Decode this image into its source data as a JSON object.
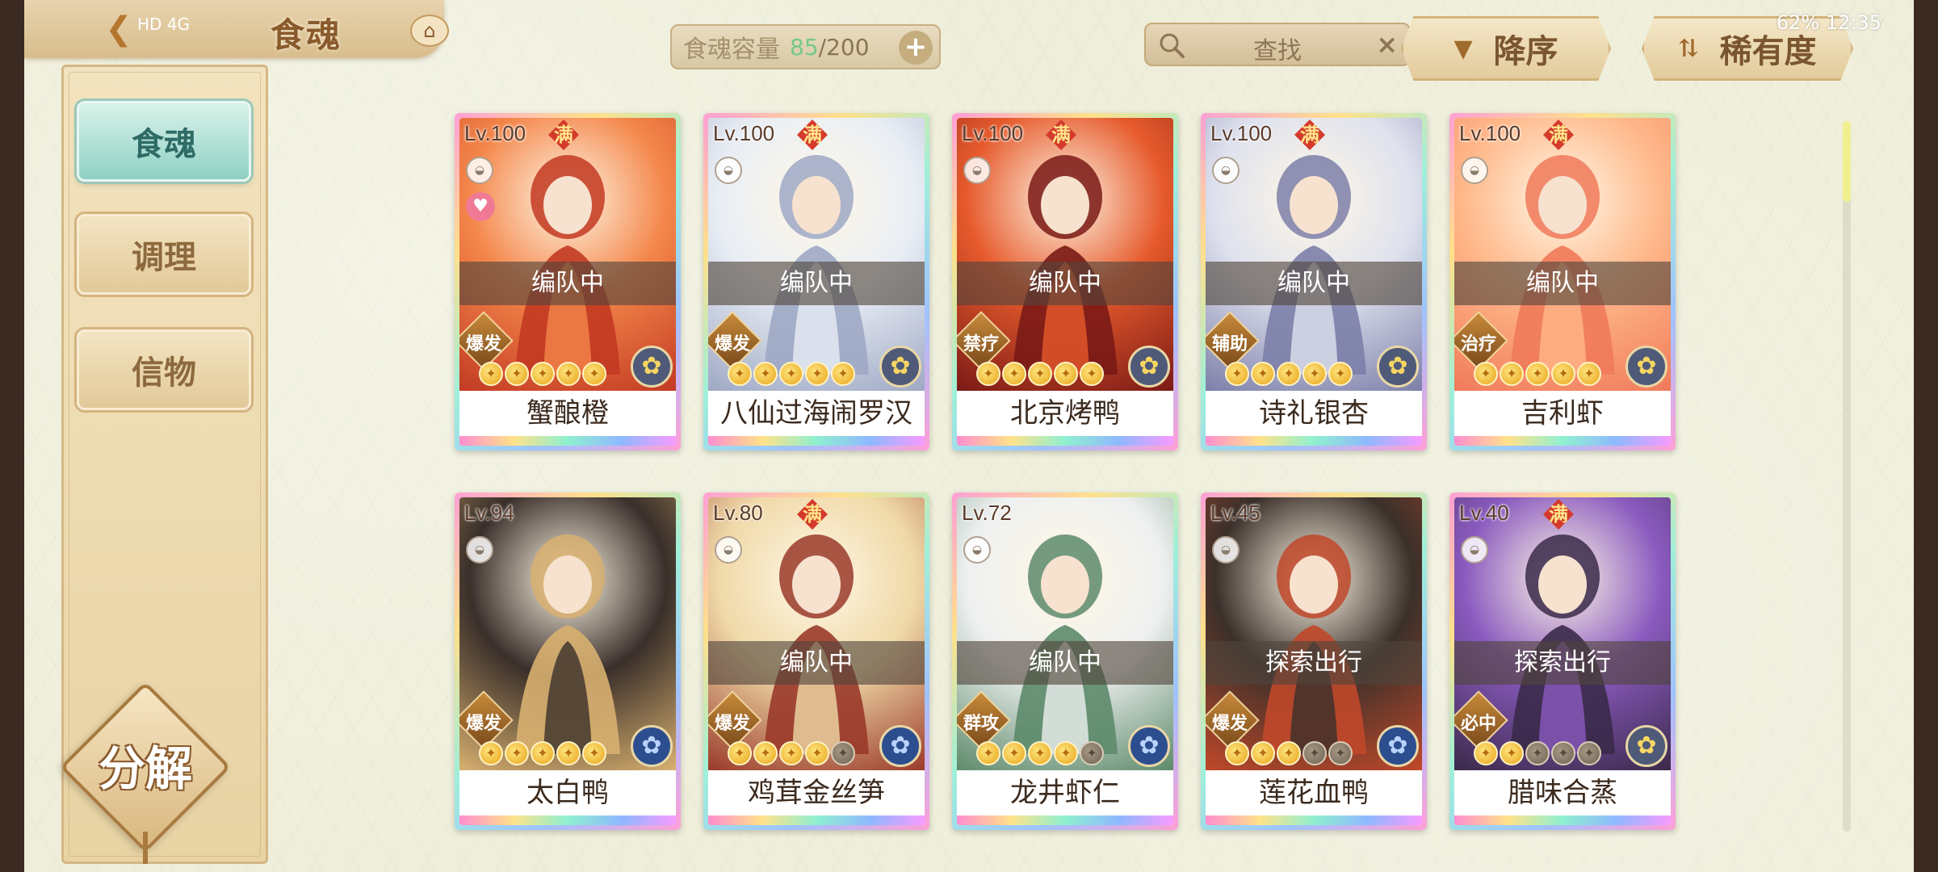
{
  "header": {
    "title": "食魂",
    "status_left": "HD 4G",
    "status_right": "62% 12:35",
    "back_icon": "back-arrow-icon",
    "home_icon": "pavilion-icon"
  },
  "capacity": {
    "label": "食魂容量",
    "current": "85",
    "separator": "/",
    "max": "200",
    "current_color": "#75c98b"
  },
  "search": {
    "placeholder": "查找",
    "clear": "×"
  },
  "sort": {
    "order_label": "降序",
    "rarity_label": "稀有度"
  },
  "sidebar": {
    "items": [
      {
        "label": "食魂",
        "active": true
      },
      {
        "label": "调理",
        "active": false
      },
      {
        "label": "信物",
        "active": false
      }
    ],
    "decompose_label": "分解"
  },
  "cards": [
    {
      "level": "Lv.100",
      "full": "满",
      "state": "编队中",
      "role": "爆发",
      "name": "蟹酿橙",
      "stars": 5,
      "max_stars": 5,
      "element": "gold",
      "palette": [
        "#f4864a",
        "#c23a22"
      ],
      "heart": true
    },
    {
      "level": "Lv.100",
      "full": "满",
      "state": "编队中",
      "role": "爆发",
      "name": "八仙过海闹罗汉",
      "stars": 5,
      "max_stars": 5,
      "element": "gold",
      "palette": [
        "#e9eef5",
        "#9ea8c4"
      ],
      "heart": false
    },
    {
      "level": "Lv.100",
      "full": "满",
      "state": "编队中",
      "role": "禁疗",
      "name": "北京烤鸭",
      "stars": 5,
      "max_stars": 5,
      "element": "gold",
      "palette": [
        "#e65a2c",
        "#7a1a16"
      ],
      "heart": false
    },
    {
      "level": "Lv.100",
      "full": "满",
      "state": "编队中",
      "role": "辅助",
      "name": "诗礼银杏",
      "stars": 5,
      "max_stars": 5,
      "element": "gold",
      "palette": [
        "#dfe2ee",
        "#7c7fa8"
      ],
      "heart": false
    },
    {
      "level": "Lv.100",
      "full": "满",
      "state": "编队中",
      "role": "治疗",
      "name": "吉利虾",
      "stars": 5,
      "max_stars": 5,
      "element": "gold",
      "palette": [
        "#ffb88a",
        "#f07a5a"
      ],
      "heart": false
    },
    {
      "level": "Lv.94",
      "full": "",
      "state": "",
      "role": "爆发",
      "name": "太白鸭",
      "stars": 5,
      "max_stars": 5,
      "element": "blue",
      "palette": [
        "#3a2f2a",
        "#d8b070"
      ],
      "heart": false
    },
    {
      "level": "Lv.80",
      "full": "满",
      "state": "编队中",
      "role": "爆发",
      "name": "鸡茸金丝笋",
      "stars": 4,
      "max_stars": 5,
      "element": "blue",
      "palette": [
        "#f0d9a8",
        "#9a3a2a"
      ],
      "heart": false
    },
    {
      "level": "Lv.72",
      "full": "",
      "state": "编队中",
      "role": "群攻",
      "name": "龙井虾仁",
      "stars": 4,
      "max_stars": 5,
      "element": "blue",
      "palette": [
        "#eef0f0",
        "#5d8a6a"
      ],
      "heart": false
    },
    {
      "level": "Lv.45",
      "full": "",
      "state": "探索出行",
      "role": "爆发",
      "name": "莲花血鸭",
      "stars": 3,
      "max_stars": 5,
      "element": "blue",
      "palette": [
        "#3b302a",
        "#c0482a"
      ],
      "heart": false
    },
    {
      "level": "Lv.40",
      "full": "满",
      "state": "探索出行",
      "role": "必中",
      "name": "腊味合蒸",
      "stars": 2,
      "max_stars": 5,
      "element": "gold",
      "palette": [
        "#8a5abf",
        "#3b2a4a"
      ],
      "heart": false
    }
  ],
  "scroll": {
    "position": 0.0
  }
}
